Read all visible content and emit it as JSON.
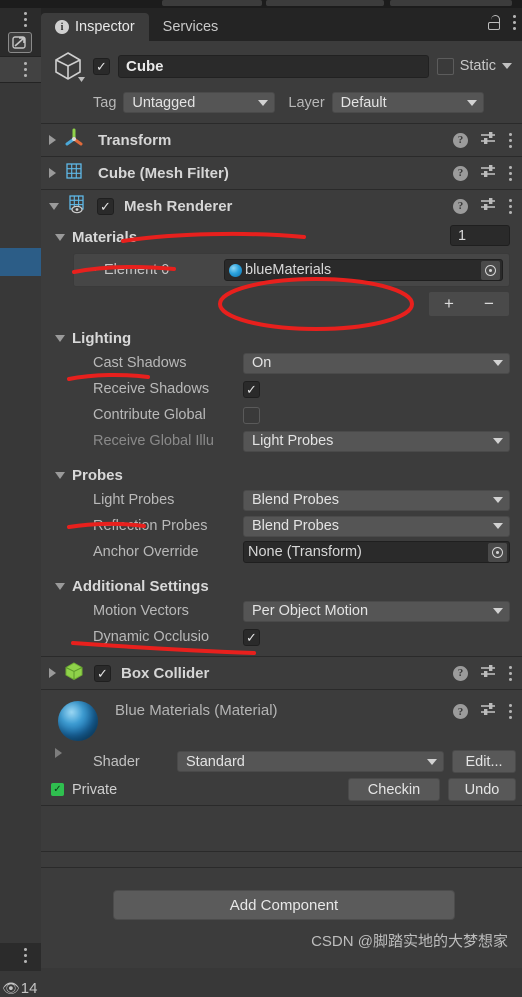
{
  "left_rail": {
    "status_count": "14",
    "icons": [
      "kebab-menu",
      "expand-icon",
      "kebab-menu",
      "eye-icon"
    ]
  },
  "tabs": [
    {
      "label": "Inspector",
      "icon": "info-icon",
      "active": true
    },
    {
      "label": "Services",
      "icon": null,
      "active": false
    }
  ],
  "tabbar_actions": {
    "lock": "lock-icon",
    "menu": "kebab-menu"
  },
  "object_header": {
    "icon": "cube-icon",
    "enabled": true,
    "name": "Cube",
    "static_label": "Static",
    "static_checked": false,
    "tag_label": "Tag",
    "tag_value": "Untagged",
    "layer_label": "Layer",
    "layer_value": "Default"
  },
  "components": [
    {
      "name": "Transform",
      "icon": "transform-axes-icon",
      "expanded": false,
      "has_enable_toggle": false
    },
    {
      "name": "Cube (Mesh Filter)",
      "icon": "mesh-grid-icon",
      "expanded": false,
      "has_enable_toggle": false
    },
    {
      "name": "Mesh Renderer",
      "icon": "mesh-renderer-icon",
      "expanded": true,
      "has_enable_toggle": true,
      "enabled": true
    }
  ],
  "mesh_renderer": {
    "materials": {
      "title": "Materials",
      "count": "1",
      "element_label": "Element 0",
      "element_value": "blueMaterials",
      "add_label": "+",
      "remove_label": "−"
    },
    "lighting": {
      "title": "Lighting",
      "rows": [
        {
          "label": "Cast Shadows",
          "type": "dropdown",
          "value": "On",
          "dim": false
        },
        {
          "label": "Receive Shadows",
          "type": "checkbox",
          "value": true,
          "dim": false
        },
        {
          "label": "Contribute Global",
          "type": "checkbox",
          "value": false,
          "dim": false
        },
        {
          "label": "Receive Global Illu",
          "type": "dropdown",
          "value": "Light Probes",
          "dim": true
        }
      ]
    },
    "probes": {
      "title": "Probes",
      "rows": [
        {
          "label": "Light Probes",
          "type": "dropdown",
          "value": "Blend Probes",
          "dim": false
        },
        {
          "label": "Reflection Probes",
          "type": "dropdown",
          "value": "Blend Probes",
          "dim": false
        },
        {
          "label": "Anchor Override",
          "type": "objectfield",
          "value": "None (Transform)",
          "dim": false
        }
      ]
    },
    "additional_settings": {
      "title": "Additional Settings",
      "rows": [
        {
          "label": "Motion Vectors",
          "type": "dropdown",
          "value": "Per Object Motion",
          "dim": false
        },
        {
          "label": "Dynamic Occlusio",
          "type": "checkbox",
          "value": true,
          "dim": false
        }
      ]
    }
  },
  "box_collider": {
    "name": "Box Collider",
    "icon": "collider-cube-icon",
    "enabled": true,
    "expanded": false
  },
  "material_block": {
    "title": "Blue Materials (Material)",
    "shader_label": "Shader",
    "shader_value": "Standard",
    "edit_label": "Edit...",
    "private_label": "Private",
    "checkin_label": "Checkin",
    "undo_label": "Undo"
  },
  "footer": {
    "add_component_label": "Add Component",
    "watermark": "CSDN @脚踏实地的大梦想家"
  },
  "annotation_color": "#e8201d"
}
